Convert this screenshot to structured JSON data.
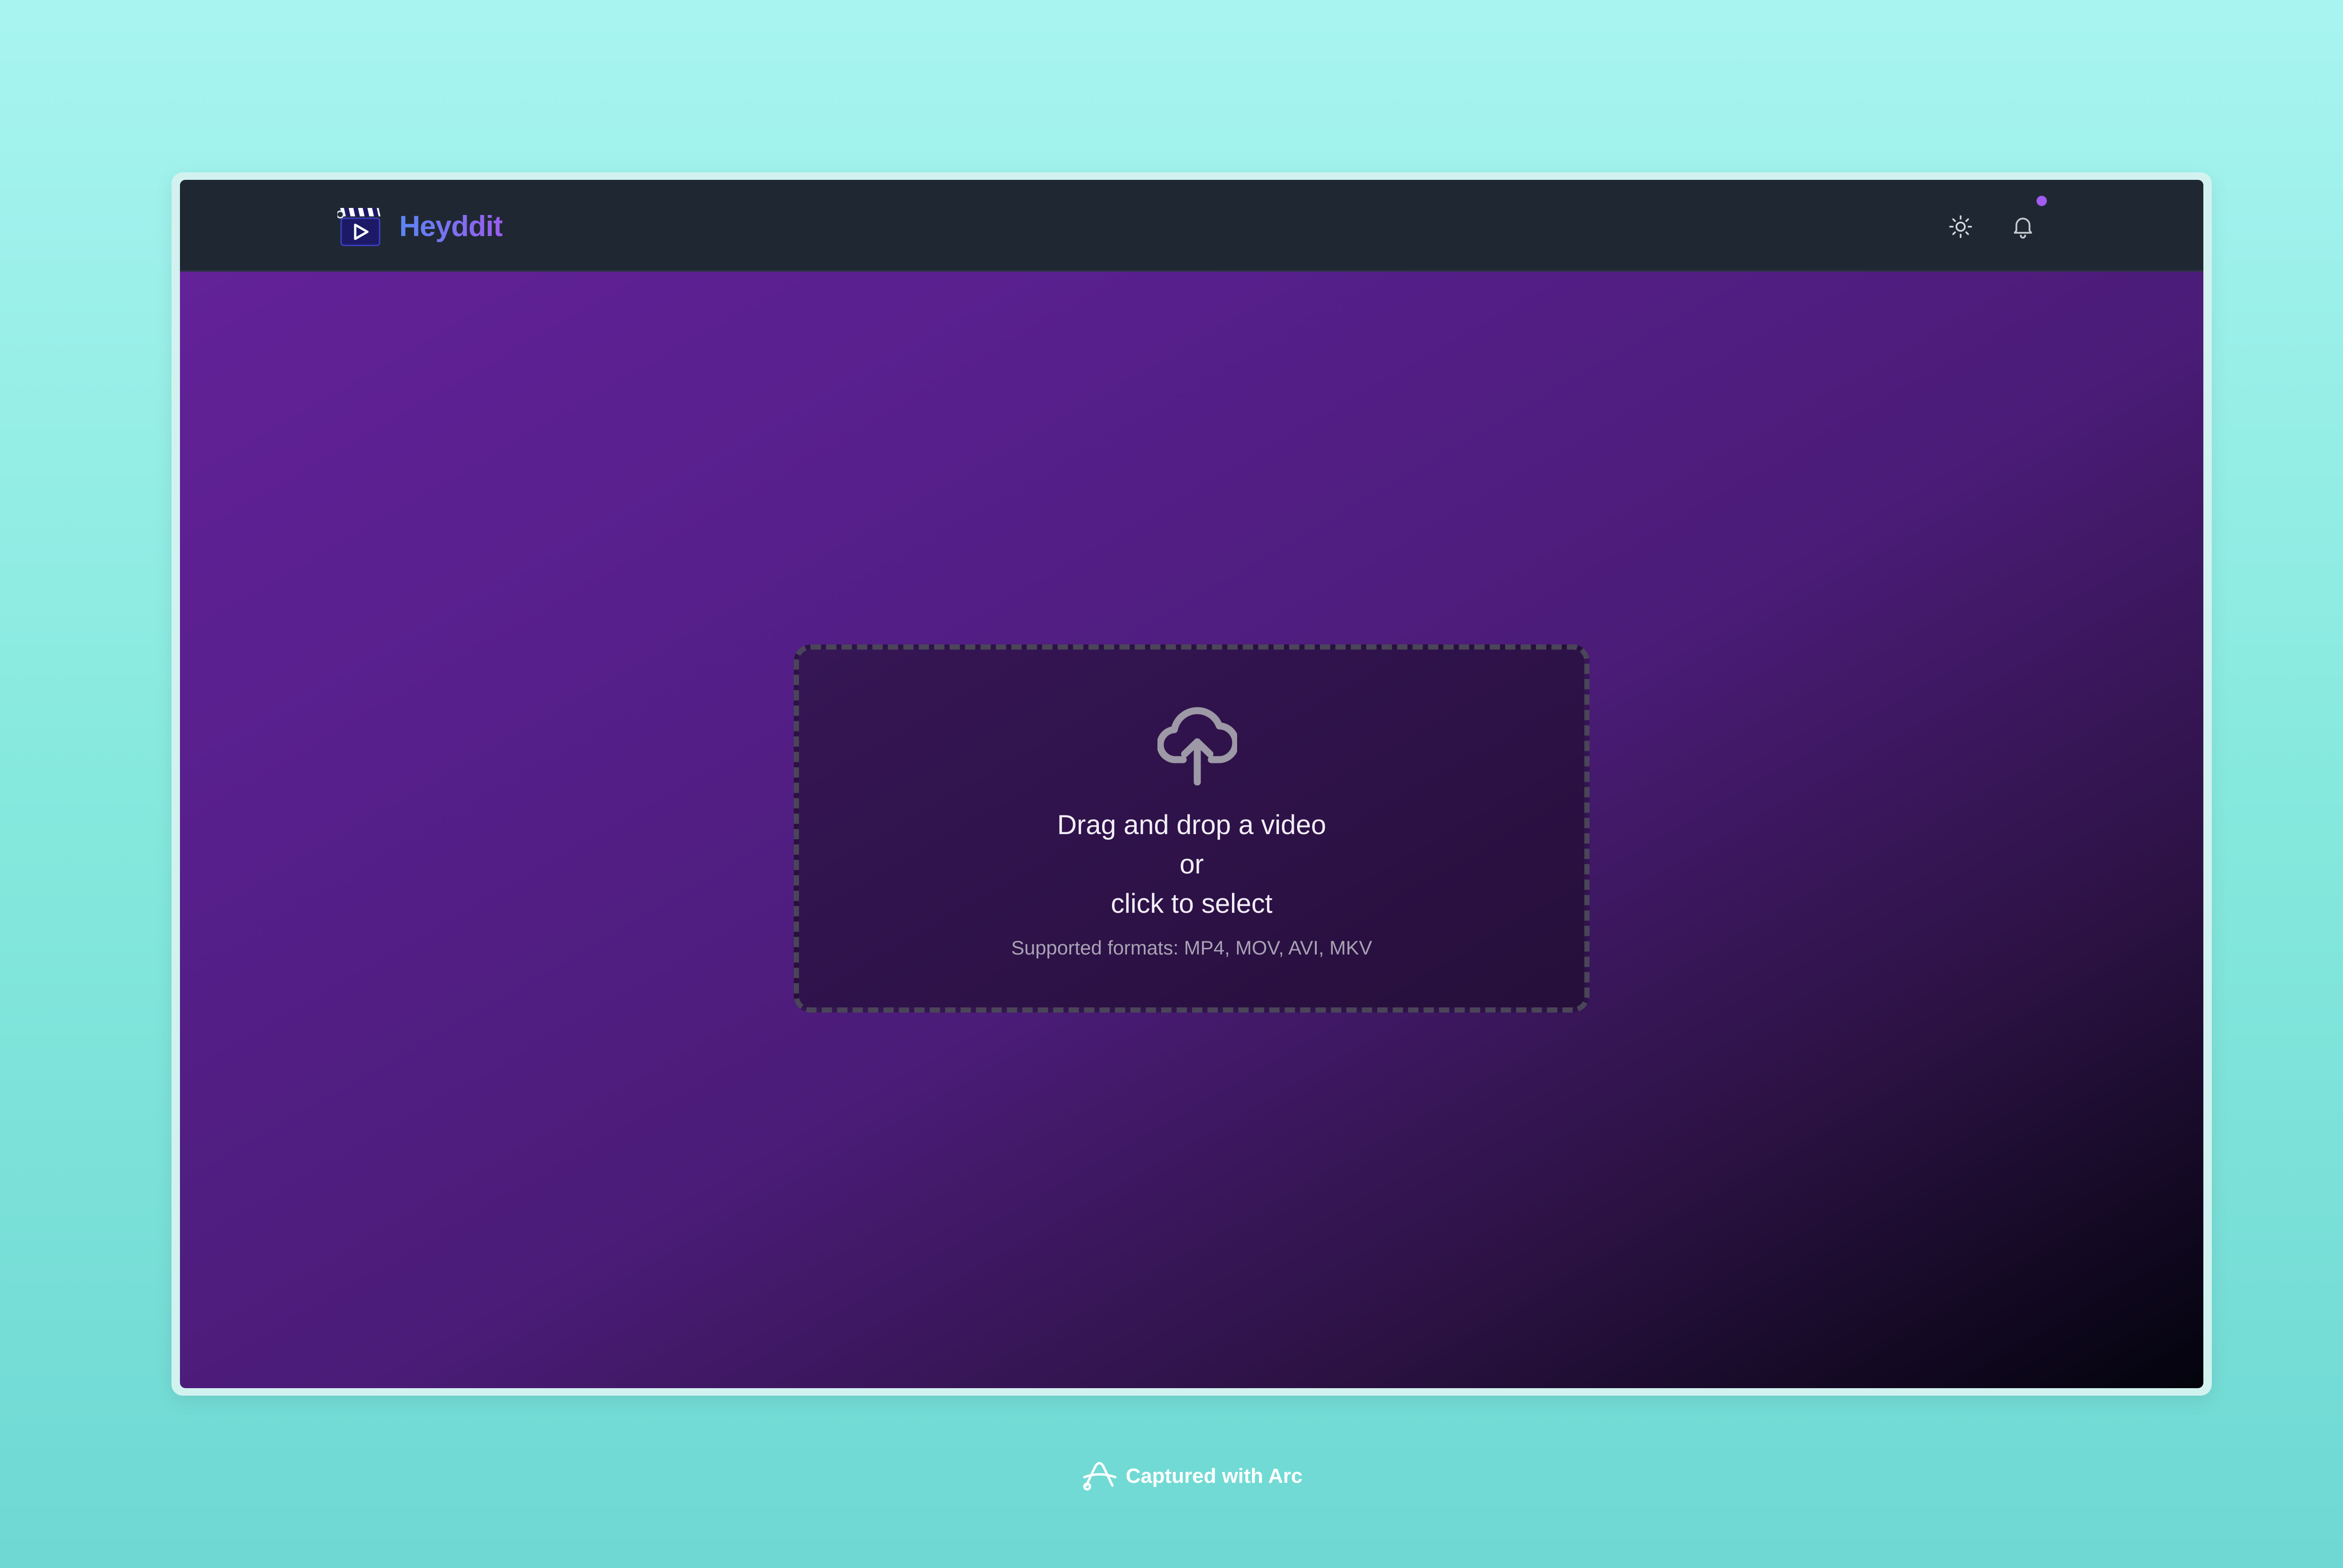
{
  "app": {
    "brand_name": "Heyddit"
  },
  "navbar": {
    "theme_icon": "sun-icon",
    "notifications_icon": "bell-icon",
    "has_unread_notifications": true
  },
  "dropzone": {
    "line1": "Drag and drop a video",
    "line2": "or",
    "line3": "click to select",
    "formats": "Supported formats: MP4, MOV, AVI, MKV",
    "icon": "cloud-upload-icon"
  },
  "footer": {
    "text": "Captured with Arc",
    "icon": "arc-logo-icon"
  },
  "colors": {
    "accent": "#9b5cf0",
    "brand_gradient_start": "#5b86f2",
    "brand_gradient_end": "#9b5cf0",
    "navbar_bg": "#1f2832",
    "background_top": "#a8f4f1",
    "background_bottom": "#6fd8d3"
  }
}
